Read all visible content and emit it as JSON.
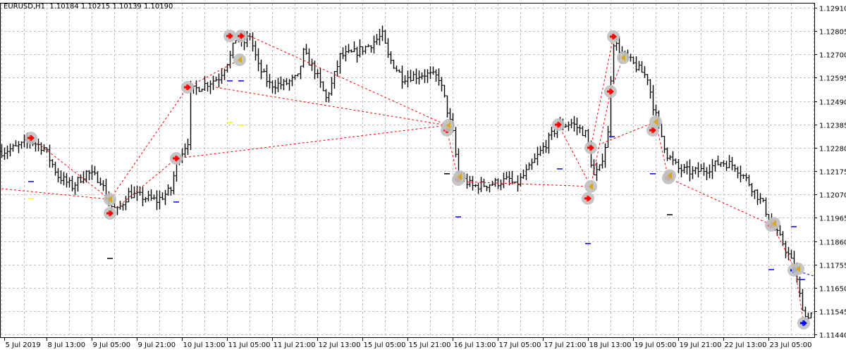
{
  "header": {
    "symbol": "EURUSD,H1",
    "ohlc": "1.10184 1.10215 1.10139 1.10190"
  },
  "colors": {
    "background": "#ffffff",
    "grid": "#c0c0c0",
    "bars": "#000000",
    "zigzag": "#ff0000",
    "marker_circle": "#c0c0c0",
    "arrow_red": "#ff0000",
    "arrow_orange": "#daa520",
    "arrow_blue": "#0000ff",
    "dash_blue": "#0000ff",
    "dash_yellow": "#ffff00",
    "dash_black": "#000000"
  },
  "chart_data": {
    "type": "ohlc-bar",
    "title": "EURUSD,H1",
    "ylim": [
      1.11405,
      1.12945
    ],
    "xlim_bars": [
      0,
      288
    ],
    "y_ticks": [
      "1.12910",
      "1.12805",
      "1.12700",
      "1.12595",
      "1.12490",
      "1.12385",
      "1.12280",
      "1.12175",
      "1.12070",
      "1.11965",
      "1.11860",
      "1.11755",
      "1.11650",
      "1.11545",
      "1.11440"
    ],
    "x_ticks": [
      {
        "bar": 1,
        "label": "5 Jul 2019"
      },
      {
        "bar": 16,
        "label": "8 Jul 13:00"
      },
      {
        "bar": 32,
        "label": "9 Jul 05:00"
      },
      {
        "bar": 48,
        "label": "9 Jul 21:00"
      },
      {
        "bar": 64,
        "label": "10 Jul 13:00"
      },
      {
        "bar": 80,
        "label": "11 Jul 05:00"
      },
      {
        "bar": 96,
        "label": "11 Jul 21:00"
      },
      {
        "bar": 112,
        "label": "12 Jul 13:00"
      },
      {
        "bar": 128,
        "label": "15 Jul 05:00"
      },
      {
        "bar": 144,
        "label": "15 Jul 21:00"
      },
      {
        "bar": 160,
        "label": "16 Jul 13:00"
      },
      {
        "bar": 176,
        "label": "17 Jul 05:00"
      },
      {
        "bar": 192,
        "label": "17 Jul 21:00"
      },
      {
        "bar": 208,
        "label": "18 Jul 13:00"
      },
      {
        "bar": 224,
        "label": "19 Jul 05:00"
      },
      {
        "bar": 240,
        "label": "19 Jul 21:00"
      },
      {
        "bar": 256,
        "label": "22 Jul 13:00"
      },
      {
        "bar": 272,
        "label": "23 Jul 05:00"
      }
    ],
    "close_path": [
      [
        0,
        1.12264
      ],
      [
        5,
        1.1228
      ],
      [
        10,
        1.12311
      ],
      [
        15,
        1.1228
      ],
      [
        20,
        1.12153
      ],
      [
        25,
        1.12106
      ],
      [
        30,
        1.12169
      ],
      [
        35,
        1.12137
      ],
      [
        38,
        1.12026
      ],
      [
        41,
        1.11995
      ],
      [
        45,
        1.12074
      ],
      [
        50,
        1.12058
      ],
      [
        55,
        1.12042
      ],
      [
        60,
        1.1209
      ],
      [
        62,
        1.12216
      ],
      [
        66,
        1.12311
      ],
      [
        67,
        1.12533
      ],
      [
        72,
        1.12565
      ],
      [
        77,
        1.12596
      ],
      [
        81,
        1.12691
      ],
      [
        83,
        1.12771
      ],
      [
        86,
        1.12755
      ],
      [
        88,
        1.12786
      ],
      [
        91,
        1.12644
      ],
      [
        95,
        1.12565
      ],
      [
        100,
        1.12565
      ],
      [
        105,
        1.12596
      ],
      [
        107,
        1.12707
      ],
      [
        111,
        1.12628
      ],
      [
        115,
        1.12501
      ],
      [
        117,
        1.12565
      ],
      [
        120,
        1.12691
      ],
      [
        125,
        1.12707
      ],
      [
        130,
        1.12739
      ],
      [
        135,
        1.12786
      ],
      [
        137,
        1.12691
      ],
      [
        142,
        1.12596
      ],
      [
        150,
        1.12612
      ],
      [
        155,
        1.12596
      ],
      [
        157,
        1.12501
      ],
      [
        160,
        1.12343
      ],
      [
        162,
        1.12153
      ],
      [
        167,
        1.12106
      ],
      [
        175,
        1.12121
      ],
      [
        180,
        1.12137
      ],
      [
        182,
        1.12106
      ],
      [
        187,
        1.12185
      ],
      [
        192,
        1.1228
      ],
      [
        197,
        1.12375
      ],
      [
        202,
        1.12391
      ],
      [
        207,
        1.12343
      ],
      [
        210,
        1.12153
      ],
      [
        212,
        1.12185
      ],
      [
        215,
        1.12343
      ],
      [
        216,
        1.12596
      ],
      [
        217,
        1.12755
      ],
      [
        221,
        1.12691
      ],
      [
        225,
        1.12644
      ],
      [
        229,
        1.12596
      ],
      [
        231,
        1.1247
      ],
      [
        233,
        1.12375
      ],
      [
        236,
        1.12248
      ],
      [
        240,
        1.12185
      ],
      [
        245,
        1.12169
      ],
      [
        250,
        1.12185
      ],
      [
        255,
        1.12216
      ],
      [
        260,
        1.122
      ],
      [
        265,
        1.12121
      ],
      [
        270,
        1.12026
      ],
      [
        273,
        1.11931
      ],
      [
        277,
        1.11852
      ],
      [
        281,
        1.11741
      ],
      [
        283,
        1.11615
      ],
      [
        285,
        1.1152
      ],
      [
        287,
        1.11535
      ]
    ],
    "zigzag_lines": [
      [
        [
          0,
          1.12096
        ],
        [
          38.5,
          1.12048
        ]
      ],
      [
        [
          10.5,
          1.12324
        ],
        [
          38.5,
          1.12048
        ]
      ],
      [
        [
          38.5,
          1.11985
        ],
        [
          62,
          1.12232
        ]
      ],
      [
        [
          62,
          1.12232
        ],
        [
          158,
          1.12381
        ]
      ],
      [
        [
          38.5,
          1.12048
        ],
        [
          66,
          1.12552
        ]
      ],
      [
        [
          66,
          1.12552
        ],
        [
          84.5,
          1.12676
        ]
      ],
      [
        [
          76,
          1.12552
        ],
        [
          158,
          1.12381
        ]
      ],
      [
        [
          88,
          1.12783
        ],
        [
          158,
          1.12381
        ]
      ],
      [
        [
          158,
          1.12359
        ],
        [
          162,
          1.12137
        ]
      ],
      [
        [
          162,
          1.12128
        ],
        [
          209,
          1.12106
        ]
      ],
      [
        [
          197.5,
          1.12384
        ],
        [
          209,
          1.12106
        ]
      ],
      [
        [
          209,
          1.12106
        ],
        [
          216,
          1.12533
        ]
      ],
      [
        [
          216,
          1.12533
        ],
        [
          220.5,
          1.12685
        ]
      ],
      [
        [
          209,
          1.1228
        ],
        [
          217,
          1.1278
        ]
      ],
      [
        [
          213,
          1.123
        ],
        [
          232,
          1.12397
        ]
      ],
      [
        [
          232,
          1.12397
        ],
        [
          236.5,
          1.12144
        ]
      ],
      [
        [
          236.5,
          1.12144
        ],
        [
          273.5,
          1.11931
        ]
      ],
      [
        [
          273.5,
          1.11931
        ],
        [
          281.5,
          1.11729
        ]
      ],
      [
        [
          281.5,
          1.11729
        ],
        [
          284.5,
          1.11491
        ]
      ]
    ],
    "blue_line": [
      [
        281.5,
        1.11729
      ],
      [
        288,
        1.11703
      ]
    ],
    "markers": [
      [
        10.5,
        1.12324,
        "red"
      ],
      [
        38.5,
        1.12048,
        "orange"
      ],
      [
        38.5,
        1.11985,
        "red"
      ],
      [
        62,
        1.12232,
        "red"
      ],
      [
        66,
        1.12552,
        "red"
      ],
      [
        81,
        1.12783,
        "red"
      ],
      [
        85,
        1.12783,
        "red"
      ],
      [
        84.5,
        1.12676,
        "orange"
      ],
      [
        158,
        1.12359,
        "red"
      ],
      [
        158.5,
        1.12381,
        "orange"
      ],
      [
        162,
        1.12137,
        "red"
      ],
      [
        162.5,
        1.1215,
        "orange"
      ],
      [
        197.5,
        1.12384,
        "red"
      ],
      [
        209,
        1.1228,
        "red"
      ],
      [
        209,
        1.12106,
        "orange"
      ],
      [
        208,
        1.12052,
        "red"
      ],
      [
        216,
        1.12533,
        "red"
      ],
      [
        217,
        1.1278,
        "red"
      ],
      [
        220.5,
        1.12685,
        "orange"
      ],
      [
        231,
        1.12359,
        "red"
      ],
      [
        232,
        1.12397,
        "orange"
      ],
      [
        236.5,
        1.12144,
        "red"
      ],
      [
        237,
        1.12155,
        "orange"
      ],
      [
        273,
        1.11931,
        "red"
      ],
      [
        274,
        1.1194,
        "orange"
      ],
      [
        281,
        1.11729,
        "blue"
      ],
      [
        282.5,
        1.11735,
        "orange"
      ],
      [
        284.5,
        1.11491,
        "blue"
      ]
    ],
    "dashes": [
      [
        10.5,
        1.12128,
        "blue"
      ],
      [
        10.5,
        1.12052,
        "yellow"
      ],
      [
        38.5,
        1.11782,
        "black"
      ],
      [
        62,
        1.12036,
        "blue"
      ],
      [
        81,
        1.12394,
        "yellow"
      ],
      [
        85,
        1.12381,
        "yellow"
      ],
      [
        81,
        1.12581,
        "blue"
      ],
      [
        85,
        1.12581,
        "blue"
      ],
      [
        158,
        1.12163,
        "black"
      ],
      [
        162,
        1.11969,
        "blue"
      ],
      [
        198,
        1.12185,
        "blue"
      ],
      [
        208,
        1.11849,
        "blue"
      ],
      [
        216.5,
        1.1233,
        "blue"
      ],
      [
        231,
        1.12163,
        "blue"
      ],
      [
        237,
        1.11979,
        "black"
      ],
      [
        273,
        1.11732,
        "blue"
      ],
      [
        281,
        1.11925,
        "blue"
      ],
      [
        284,
        1.11687,
        "blue"
      ]
    ]
  }
}
